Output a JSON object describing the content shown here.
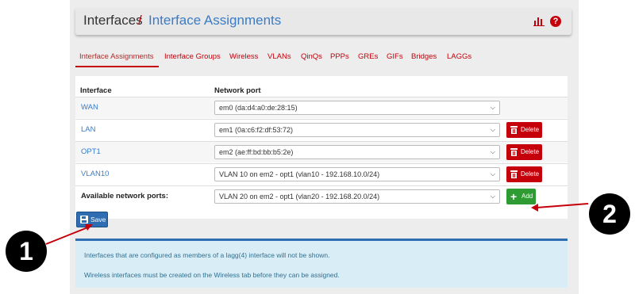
{
  "header": {
    "crumb_parent": "Interfaces",
    "separator": "/",
    "crumb_current": "Interface Assignments",
    "icons": [
      "chart-icon",
      "help-icon"
    ],
    "help_glyph": "?"
  },
  "tabs": [
    {
      "label": "Interface Assignments",
      "active": true
    },
    {
      "label": "Interface Groups",
      "active": false
    },
    {
      "label": "Wireless",
      "active": false
    },
    {
      "label": "VLANs",
      "active": false
    },
    {
      "label": "QinQs",
      "active": false
    },
    {
      "label": "PPPs",
      "active": false
    },
    {
      "label": "GREs",
      "active": false
    },
    {
      "label": "GIFs",
      "active": false
    },
    {
      "label": "Bridges",
      "active": false
    },
    {
      "label": "LAGGs",
      "active": false
    }
  ],
  "table": {
    "columns": [
      "Interface",
      "Network port"
    ],
    "rows": [
      {
        "interface": "WAN",
        "port": "em0 (da:d4:a0:de:28:15)",
        "action": ""
      },
      {
        "interface": "LAN",
        "port": "em1 (0a:c6:f2:df:53:72)",
        "action": "Delete"
      },
      {
        "interface": "OPT1",
        "port": "em2 (ae:ff:bd:bb:b5:2e)",
        "action": "Delete"
      },
      {
        "interface": "VLAN10",
        "port": "VLAN 10 on em2 - opt1 (vlan10 - 192.168.10.0/24)",
        "action": "Delete"
      }
    ],
    "available": {
      "label": "Available network ports:",
      "port": "VLAN 20 on em2 - opt1 (vlan20 - 192.168.20.0/24)",
      "action": "Add"
    }
  },
  "save_label": "Save",
  "info": {
    "line1": "Interfaces that are configured as members of a lagg(4) interface will not be shown.",
    "line2": "Wireless interfaces must be created on the Wireless tab before they can be assigned."
  },
  "callouts": {
    "one": "1",
    "two": "2"
  },
  "colors": {
    "accent_red": "#c5000b",
    "link_blue": "#3a7cc7",
    "save_blue": "#2f6db3",
    "add_green": "#2e9b33",
    "info_bg": "#d9edf7"
  }
}
